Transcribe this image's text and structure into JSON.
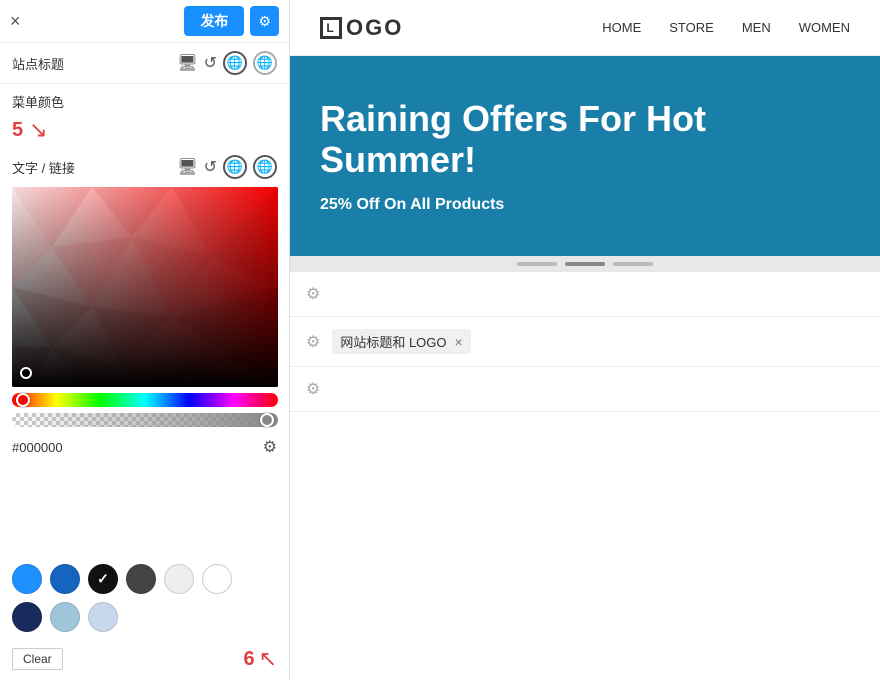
{
  "left_panel": {
    "close_label": "×",
    "publish_label": "发布",
    "gear_label": "⚙",
    "site_title_label": "站点标题",
    "menu_color_label": "菜单颜色",
    "text_link_label": "文字 / 链接",
    "step5_number": "5",
    "step6_number": "6",
    "hex_value": "#000000",
    "clear_label": "Clear"
  },
  "swatches": {
    "row1": [
      {
        "color": "#1e90ff",
        "selected": false
      },
      {
        "color": "#1565c0",
        "selected": false
      },
      {
        "color": "#111111",
        "selected": true
      },
      {
        "color": "#444444",
        "selected": false
      },
      {
        "color": "#eeeeee",
        "selected": false
      },
      {
        "color": "#ffffff",
        "selected": false
      }
    ],
    "row2": [
      {
        "color": "#1a2a5c",
        "selected": false
      },
      {
        "color": "#9ec5d8",
        "selected": false
      },
      {
        "color": "#c8d8ec",
        "selected": false
      }
    ]
  },
  "right_panel": {
    "logo_text": "OGO",
    "nav_items": [
      "HOME",
      "STORE",
      "MEN",
      "WOMEN"
    ],
    "hero_title": "Raining Offers For Hot Summer!",
    "hero_subtitle": "25% Off On All Products",
    "widget_tag_label": "网站标题和 LOGO",
    "widget_tag_close": "×"
  }
}
